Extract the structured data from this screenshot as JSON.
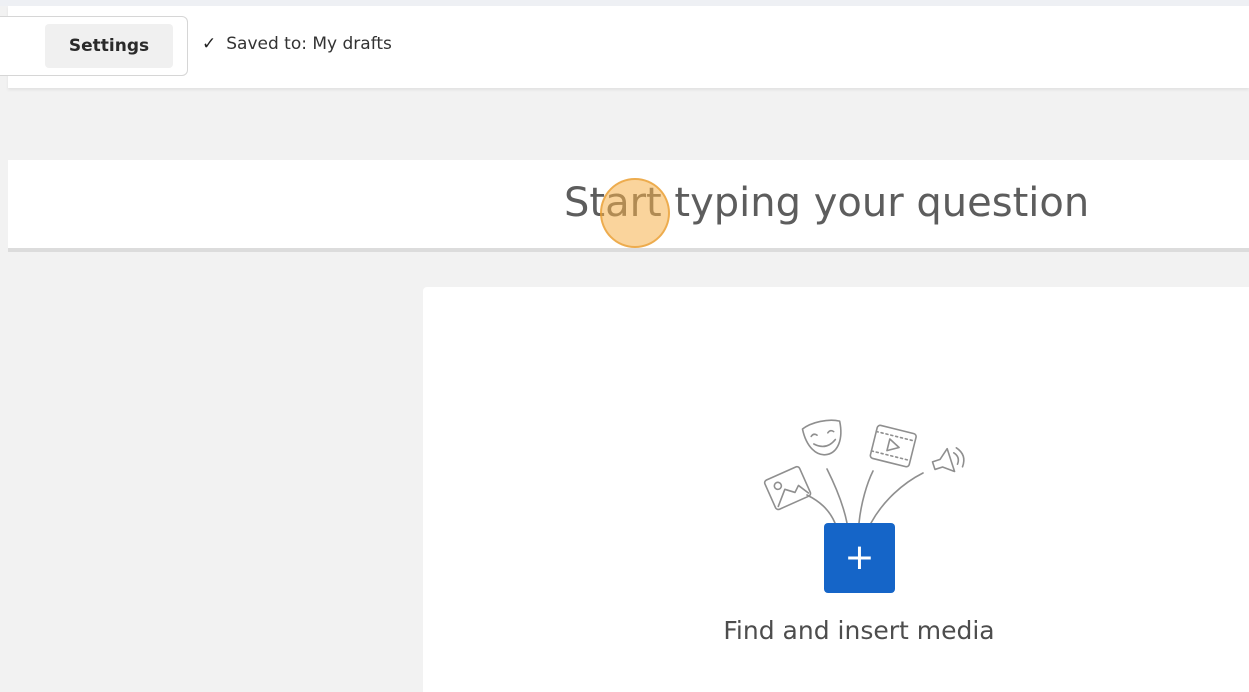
{
  "toolbar": {
    "settings_label": "Settings",
    "saved_check": "✓",
    "saved_text": "Saved to: My drafts"
  },
  "question": {
    "placeholder": "Start typing your question"
  },
  "media": {
    "add_symbol": "+",
    "label": "Find and insert media",
    "button_color": "#1565c8"
  },
  "icons": [
    "image-icon",
    "theater-mask-icon",
    "video-icon",
    "audio-icon",
    "plus-icon",
    "check-icon"
  ]
}
